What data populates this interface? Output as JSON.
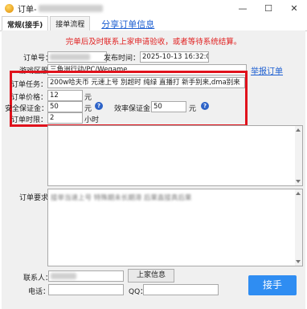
{
  "window": {
    "title": "订单-",
    "buttons": {
      "min": "—",
      "max": "☐",
      "close": "✕"
    }
  },
  "tabs": {
    "active": "常规(接手)",
    "second": "接单流程",
    "link": "分享订单信息"
  },
  "notice": "完单后及时联系上家申请验收，或者等待系统结算。",
  "order": {
    "order_no_label": "订单号：",
    "publish_time_label": "发布时间：",
    "publish_time": "2025-10-13 16:32:07",
    "region_label": "游戏区服：",
    "region": "三角洲行动/PC/Wegame",
    "report_link": "举报订单"
  },
  "highlight": {
    "task_label": "订单任务：",
    "task": "200w哈夫币 元速上号 別超时 纯绿 直播打 新手别来,dma别来",
    "price_label": "订单价格：",
    "price": "12",
    "price_unit": "元",
    "safety_label": "安全保证金：",
    "safety": "50",
    "safety_unit": "元",
    "efficiency_label": "效率保证金：",
    "efficiency": "50",
    "efficiency_unit": "元",
    "duration_label": "订单时限：",
    "duration": "2",
    "duration_unit": "小时",
    "help": "?"
  },
  "requirement": {
    "label": "订单要求：",
    "text": "接单当速上号 特殊期未长期滞 后果直接真后果"
  },
  "contact": {
    "contact_label": "联系人：",
    "contact_button": "上家信息",
    "phone_label": "电话：",
    "qq_label": "QQ："
  },
  "take_button": "接手"
}
